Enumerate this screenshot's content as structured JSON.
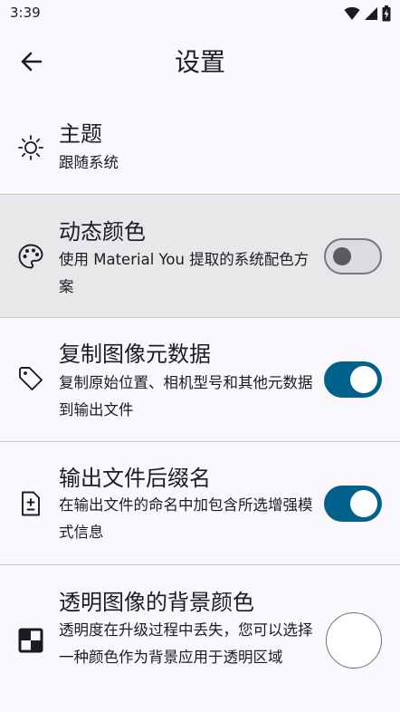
{
  "status": {
    "time": "3:39"
  },
  "header": {
    "title": "设置"
  },
  "settings": [
    {
      "title": "主题",
      "subtitle": "跟随系统"
    },
    {
      "title": "动态颜色",
      "subtitle": "使用 Material You 提取的系统配色方案",
      "switch": "off"
    },
    {
      "title": "复制图像元数据",
      "subtitle": "复制原始位置、相机型号和其他元数据到输出文件",
      "switch": "on"
    },
    {
      "title": "输出文件后缀名",
      "subtitle": "在输出文件的命名中加包含所选增强模式信息",
      "switch": "on"
    },
    {
      "title": "透明图像的背景颜色",
      "subtitle": "透明度在升级过程中丢失，您可以选择一种颜色作为背景应用于透明区域",
      "color": "#ffffff"
    }
  ],
  "colors": {
    "background": "#fbf8fd",
    "accent": "#00628a",
    "highlight": "#e8e8ea"
  }
}
